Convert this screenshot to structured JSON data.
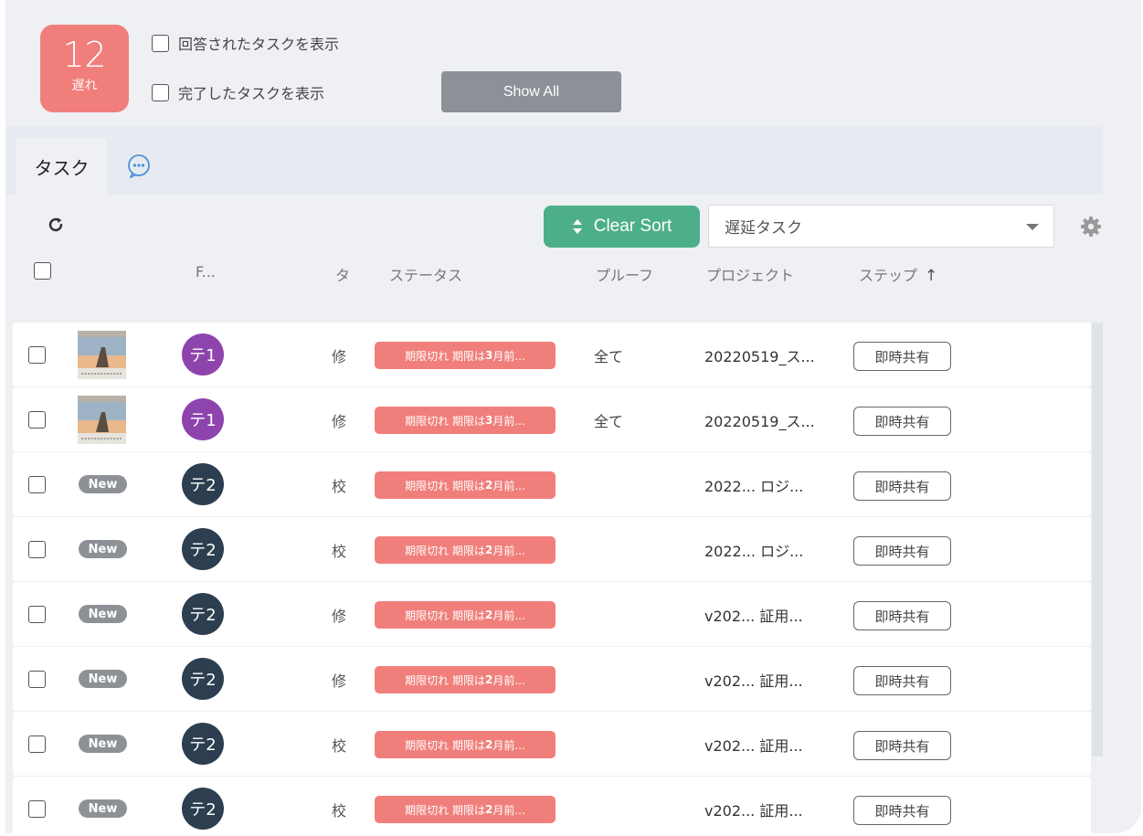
{
  "late": {
    "count": "12",
    "label": "遅れ"
  },
  "filters": {
    "show_answered": "回答されたタスクを表示",
    "show_completed": "完了したタスクを表示",
    "show_all": "Show All"
  },
  "tabs": {
    "task": "タスク"
  },
  "toolbar": {
    "clear_sort": "Clear Sort",
    "filter_selected": "遅延タスク"
  },
  "columns": {
    "file": "F...",
    "type": "タ",
    "status": "ステータス",
    "proof": "プルーフ",
    "project": "プロジェクト",
    "step": "ステップ",
    "step_sort": "↑"
  },
  "colors": {
    "late": "#f07f7b",
    "accent_green": "#4daf8a",
    "avatar_purple": "#8e44ad",
    "avatar_dark": "#2c3e50"
  },
  "rows": [
    {
      "file": "thumbnail",
      "avatar": "テ1",
      "avatar_color": "purple",
      "type": "修",
      "status_prefix": "期限切れ 期限は",
      "status_bold": "3",
      "status_suffix": "月前...",
      "proof": "全て",
      "project": "20220519_ス...",
      "step": "即時共有"
    },
    {
      "file": "thumbnail",
      "avatar": "テ1",
      "avatar_color": "purple",
      "type": "修",
      "status_prefix": "期限切れ 期限は",
      "status_bold": "3",
      "status_suffix": "月前...",
      "proof": "全て",
      "project": "20220519_ス...",
      "step": "即時共有"
    },
    {
      "file": "New",
      "avatar": "テ2",
      "avatar_color": "dark",
      "type": "校",
      "status_prefix": "期限切れ 期限は",
      "status_bold": "2",
      "status_suffix": "月前...",
      "proof": "",
      "project": "2022... ロジ...",
      "step": "即時共有"
    },
    {
      "file": "New",
      "avatar": "テ2",
      "avatar_color": "dark",
      "type": "校",
      "status_prefix": "期限切れ 期限は",
      "status_bold": "2",
      "status_suffix": "月前...",
      "proof": "",
      "project": "2022... ロジ...",
      "step": "即時共有"
    },
    {
      "file": "New",
      "avatar": "テ2",
      "avatar_color": "dark",
      "type": "修",
      "status_prefix": "期限切れ 期限は",
      "status_bold": "2",
      "status_suffix": "月前...",
      "proof": "",
      "project": "v202... 証用...",
      "step": "即時共有"
    },
    {
      "file": "New",
      "avatar": "テ2",
      "avatar_color": "dark",
      "type": "修",
      "status_prefix": "期限切れ 期限は",
      "status_bold": "2",
      "status_suffix": "月前...",
      "proof": "",
      "project": "v202... 証用...",
      "step": "即時共有"
    },
    {
      "file": "New",
      "avatar": "テ2",
      "avatar_color": "dark",
      "type": "校",
      "status_prefix": "期限切れ 期限は",
      "status_bold": "2",
      "status_suffix": "月前...",
      "proof": "",
      "project": "v202... 証用...",
      "step": "即時共有"
    },
    {
      "file": "New",
      "avatar": "テ2",
      "avatar_color": "dark",
      "type": "校",
      "status_prefix": "期限切れ 期限は",
      "status_bold": "2",
      "status_suffix": "月前...",
      "proof": "",
      "project": "v202... 証用...",
      "step": "即時共有"
    }
  ]
}
